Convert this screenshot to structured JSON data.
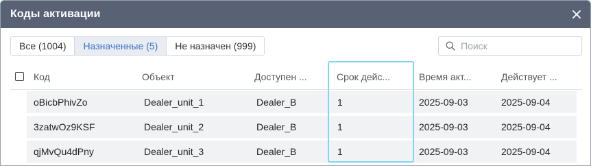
{
  "window": {
    "title": "Коды активации"
  },
  "tabs": [
    {
      "label": "Все (1004)",
      "active": false
    },
    {
      "label": "Назначенные (5)",
      "active": true
    },
    {
      "label": "Не назначен (999)",
      "active": false
    }
  ],
  "search": {
    "placeholder": "Поиск",
    "value": ""
  },
  "table": {
    "columns": [
      "Код",
      "Объект",
      "Доступен ...",
      "Срок дейс...",
      "Время акт...",
      "Действует ..."
    ],
    "rows": [
      [
        "oBicbPhivZo",
        "Dealer_unit_1",
        "Dealer_B",
        "1",
        "2025-09-03",
        "2025-09-04"
      ],
      [
        "3zatwOz9KSF",
        "Dealer_unit_2",
        "Dealer_B",
        "1",
        "2025-09-03",
        "2025-09-04"
      ],
      [
        "qjMvQu4dPny",
        "Dealer_unit_3",
        "Dealer_B",
        "1",
        "2025-09-03",
        "2025-09-04"
      ]
    ]
  },
  "colors": {
    "titlebar": "#596275",
    "active_tab_text": "#3a73c9",
    "highlight": "#7fd6ee"
  }
}
